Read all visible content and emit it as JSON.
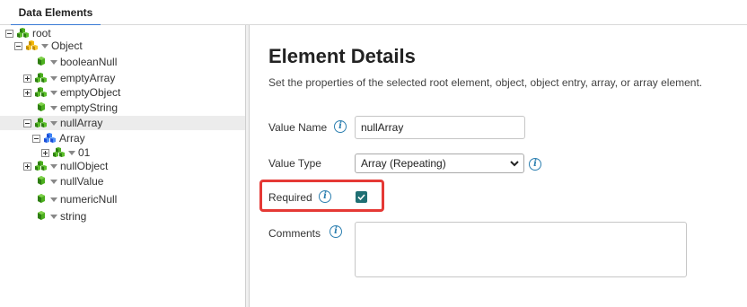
{
  "tabs": [
    {
      "label": "Data Elements"
    }
  ],
  "tree": {
    "nodes": [
      {
        "label": "root"
      },
      {
        "label": "Object"
      },
      {
        "label": "booleanNull"
      },
      {
        "label": "emptyArray"
      },
      {
        "label": "emptyObject"
      },
      {
        "label": "emptyString"
      },
      {
        "label": "nullArray"
      },
      {
        "label": "Array"
      },
      {
        "label": "01"
      },
      {
        "label": "nullObject"
      },
      {
        "label": "nullValue"
      },
      {
        "label": "numericNull"
      },
      {
        "label": "string"
      }
    ]
  },
  "details": {
    "title": "Element Details",
    "subtitle": "Set the properties of the selected root element, object, object entry, array, or array element.",
    "value_name_label": "Value Name",
    "value_name": "nullArray",
    "value_type_label": "Value Type",
    "value_type": "Array (Repeating)",
    "required_label": "Required",
    "required_checked": true,
    "comments_label": "Comments",
    "comments_value": ""
  },
  "colors": {
    "accent": "#3a7bd5",
    "checkbox": "#1f6f73",
    "info_icon": "#2c7fb0",
    "highlight": "#e53935",
    "selected_row": "#ececec"
  }
}
